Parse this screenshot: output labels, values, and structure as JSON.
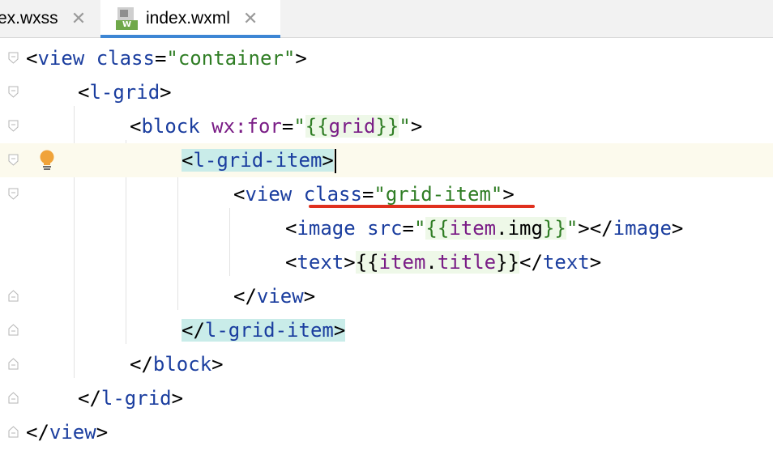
{
  "tabs": [
    {
      "label": "ex.wxss",
      "close": "✕",
      "active": false
    },
    {
      "label": "index.wxml",
      "close": "✕",
      "active": true,
      "icon_badge": "W"
    }
  ],
  "code": {
    "line1": {
      "open": "<",
      "tag": "view",
      "attr": "class",
      "eq": "=",
      "value": "\"container\"",
      "close": ">"
    },
    "line2": {
      "open": "<",
      "tag": "l-grid",
      "close": ">"
    },
    "line3": {
      "open": "<",
      "tag": "block",
      "attr": "wx:for",
      "eq": "=",
      "q1": "\"",
      "expr_open": "{{",
      "expr_var": "grid",
      "expr_close": "}}",
      "q2": "\"",
      "close": ">"
    },
    "line4": {
      "open": "<",
      "tag": "l-grid-item",
      "close": ">"
    },
    "line5": {
      "open": "<",
      "tag": "view",
      "attr": "class",
      "eq": "=",
      "value": "\"grid-item\"",
      "close": ">"
    },
    "line6": {
      "open": "<",
      "tag": "image",
      "attr": "src",
      "eq": "=",
      "q1": "\"",
      "expr_open": "{{",
      "expr_var": "item",
      "expr_dot": ".img",
      "expr_close": "}}",
      "q2": "\"",
      "close": "></",
      "tag2": "image",
      "end": ">"
    },
    "line7": {
      "open": "<",
      "tag": "text",
      "close": ">",
      "expr_open": "{{",
      "expr_var": "item",
      "expr_dot": ".",
      "expr_var2": "title",
      "expr_close": "}}",
      "close_open": "</",
      "tag2": "text",
      "end": ">"
    },
    "line8": {
      "open": "</",
      "tag": "view",
      "close": ">"
    },
    "line9": {
      "open": "</",
      "tag": "l-grid-item",
      "close": ">"
    },
    "line10": {
      "open": "</",
      "tag": "block",
      "close": ">"
    },
    "line11": {
      "open": "</",
      "tag": "l-grid",
      "close": ">"
    },
    "line12": {
      "open": "</",
      "tag": "view",
      "close": ">"
    }
  },
  "colors": {
    "tag": "#1b3e9f",
    "string": "#2f7d24",
    "variable": "#7a1d86",
    "tag_match_highlight": "#c9ece9",
    "current_line": "#fcfaed",
    "error_underline": "#e0301e",
    "active_tab_indicator": "#3d86d4"
  },
  "icons": [
    "close-icon",
    "wxml-file-icon",
    "lightbulb-icon",
    "fold-icon"
  ]
}
